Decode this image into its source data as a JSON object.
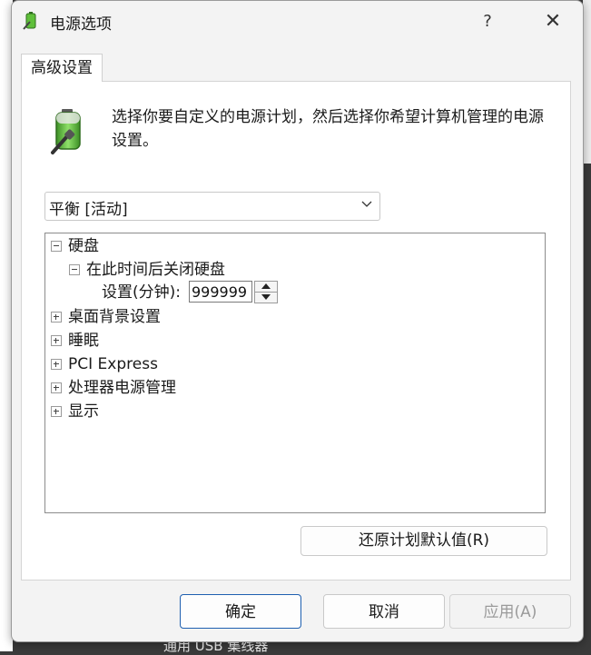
{
  "window": {
    "title": "电源选项",
    "help_label": "?",
    "close_label": "✕"
  },
  "tabs": [
    {
      "label": "高级设置"
    }
  ],
  "description": "选择你要自定义的电源计划，然后选择你希望计算机管理的电源设置。",
  "plan_select": {
    "value": "平衡 [活动]"
  },
  "tree": {
    "hard_disk": "硬盘",
    "turn_off_disk": "在此时间后关闭硬盘",
    "setting_label": "设置(分钟):",
    "setting_value": "999999",
    "desktop_background": "桌面背景设置",
    "sleep": "睡眠",
    "pci_express": "PCI Express",
    "processor_power": "处理器电源管理",
    "display": "显示"
  },
  "buttons": {
    "restore": "还原计划默认值(R)",
    "ok": "确定",
    "cancel": "取消",
    "apply": "应用(A)"
  },
  "background": {
    "partial_text": "通用 USB 集线器"
  }
}
